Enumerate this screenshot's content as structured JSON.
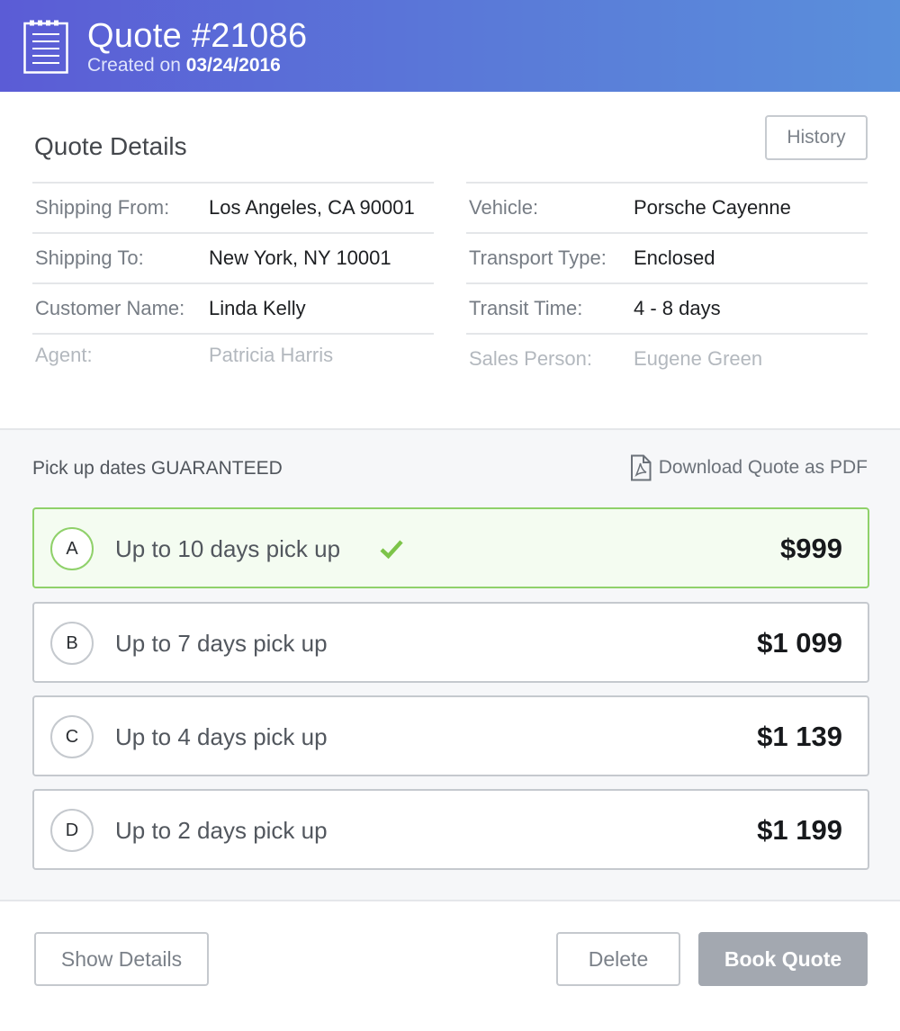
{
  "header": {
    "title": "Quote #21086",
    "created_prefix": "Created on",
    "created_date": "03/24/2016",
    "icon": "notepad-icon"
  },
  "details": {
    "title": "Quote Details",
    "history_label": "History",
    "left": [
      {
        "label": "Shipping From:",
        "value": "Los Angeles, CA 90001"
      },
      {
        "label": "Shipping To:",
        "value": "New York, NY 10001"
      },
      {
        "label": "Customer Name:",
        "value": "Linda Kelly"
      },
      {
        "label": "Agent:",
        "value": "Patricia Harris"
      }
    ],
    "right": [
      {
        "label": "Vehicle:",
        "value": "Porsche Cayenne"
      },
      {
        "label": "Transport Type:",
        "value": "Enclosed"
      },
      {
        "label": "Transit Time:",
        "value": "4 - 8 days"
      },
      {
        "label": "Sales Person:",
        "value": "Eugene Green"
      }
    ]
  },
  "options": {
    "heading": "Pick up dates GUARANTEED",
    "download_label": "Download Quote as PDF",
    "selected_index": 0,
    "items": [
      {
        "letter": "A",
        "label": "Up to 10 days pick up",
        "price": "$999"
      },
      {
        "letter": "B",
        "label": "Up to 7 days pick up",
        "price": "$1 099"
      },
      {
        "letter": "C",
        "label": "Up to 4 days pick up",
        "price": "$1 139"
      },
      {
        "letter": "D",
        "label": "Up to 2 days pick up",
        "price": "$1 199"
      }
    ]
  },
  "footer": {
    "show_details_label": "Show Details",
    "delete_label": "Delete",
    "book_label": "Book Quote"
  },
  "colors": {
    "header_gradient_start": "#5b5cd6",
    "header_gradient_end": "#5a8fdb",
    "selected_border": "#8fd16a",
    "check_green": "#7cc449",
    "book_button": "#a3a8b0"
  }
}
